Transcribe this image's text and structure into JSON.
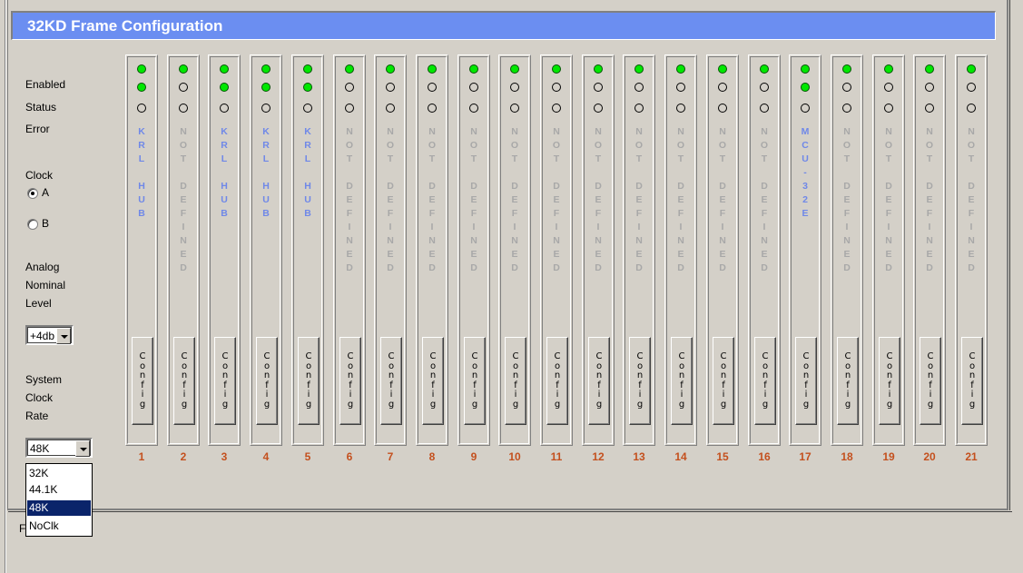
{
  "title": "32KD Frame Configuration",
  "left": {
    "enabled": "Enabled",
    "status": "Status",
    "error": "Error",
    "clock": "Clock",
    "clock_a": "A",
    "clock_b": "B",
    "analog1": "Analog",
    "analog2": "Nominal",
    "analog3": "Level",
    "analog_value": "+4db",
    "sys1": "System",
    "sys2": "Clock",
    "sys3": "Rate",
    "rate_value": "48K",
    "rate_options": [
      "32K",
      "44.1K",
      "48K",
      "NoClk"
    ],
    "trailing_char": "F"
  },
  "config_label": "Config",
  "slots": [
    {
      "num": "1",
      "label": "KRL HUB",
      "enabled": true,
      "status": true,
      "error": false
    },
    {
      "num": "2",
      "label": "NOT DEFINED",
      "enabled": true,
      "status": false,
      "error": false
    },
    {
      "num": "3",
      "label": "KRL HUB",
      "enabled": true,
      "status": true,
      "error": false
    },
    {
      "num": "4",
      "label": "KRL HUB",
      "enabled": true,
      "status": true,
      "error": false
    },
    {
      "num": "5",
      "label": "KRL HUB",
      "enabled": true,
      "status": true,
      "error": false
    },
    {
      "num": "6",
      "label": "NOT DEFINED",
      "enabled": true,
      "status": false,
      "error": false
    },
    {
      "num": "7",
      "label": "NOT DEFINED",
      "enabled": true,
      "status": false,
      "error": false
    },
    {
      "num": "8",
      "label": "NOT DEFINED",
      "enabled": true,
      "status": false,
      "error": false
    },
    {
      "num": "9",
      "label": "NOT DEFINED",
      "enabled": true,
      "status": false,
      "error": false
    },
    {
      "num": "10",
      "label": "NOT DEFINED",
      "enabled": true,
      "status": false,
      "error": false
    },
    {
      "num": "11",
      "label": "NOT DEFINED",
      "enabled": true,
      "status": false,
      "error": false
    },
    {
      "num": "12",
      "label": "NOT DEFINED",
      "enabled": true,
      "status": false,
      "error": false
    },
    {
      "num": "13",
      "label": "NOT DEFINED",
      "enabled": true,
      "status": false,
      "error": false
    },
    {
      "num": "14",
      "label": "NOT DEFINED",
      "enabled": true,
      "status": false,
      "error": false
    },
    {
      "num": "15",
      "label": "NOT DEFINED",
      "enabled": true,
      "status": false,
      "error": false
    },
    {
      "num": "16",
      "label": "NOT DEFINED",
      "enabled": true,
      "status": false,
      "error": false
    },
    {
      "num": "17",
      "label": "MCU-32E",
      "enabled": true,
      "status": true,
      "error": false
    },
    {
      "num": "18",
      "label": "NOT DEFINED",
      "enabled": true,
      "status": false,
      "error": false
    },
    {
      "num": "19",
      "label": "NOT DEFINED",
      "enabled": true,
      "status": false,
      "error": false
    },
    {
      "num": "20",
      "label": "NOT DEFINED",
      "enabled": true,
      "status": false,
      "error": false
    },
    {
      "num": "21",
      "label": "NOT DEFINED",
      "enabled": true,
      "status": false,
      "error": false
    }
  ]
}
